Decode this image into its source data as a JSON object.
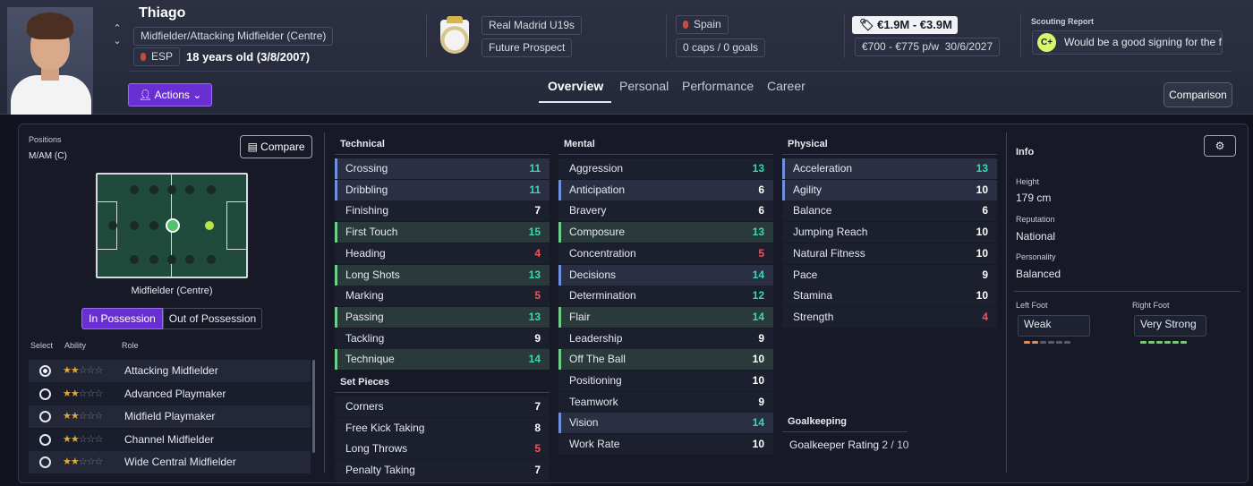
{
  "header": {
    "name": "Thiago",
    "position": "Midfielder/Attacking Midfielder (Centre)",
    "nation_code": "ESP",
    "age": "18 years old (3/8/2007)",
    "actions_label": "Actions",
    "club": "Real Madrid U19s",
    "status": "Future Prospect",
    "nationality": "Spain",
    "caps": "0 caps / 0 goals",
    "value": "€1.9M - €3.9M",
    "wage": "€700 - €775 p/w",
    "contract": "30/6/2027",
    "scout_label": "Scouting Report",
    "scout_grade": "C+",
    "scout_text": "Would be a good signing for the fu...",
    "comparison_label": "Comparison"
  },
  "tabs": [
    "Overview",
    "Personal",
    "Performance",
    "Career"
  ],
  "positions": {
    "label": "Positions",
    "value": "M/AM (C)",
    "compare_label": "Compare",
    "role_name": "Midfielder (Centre)",
    "in_possession": "In Possession",
    "out_possession": "Out of Possession",
    "col_select": "Select",
    "col_ability": "Ability",
    "col_role": "Role",
    "roles": [
      {
        "name": "Attacking Midfielder",
        "stars": "★★☆☆☆",
        "selected": true
      },
      {
        "name": "Advanced Playmaker",
        "stars": "★★☆☆☆"
      },
      {
        "name": "Midfield Playmaker",
        "stars": "★★☆☆☆"
      },
      {
        "name": "Channel Midfielder",
        "stars": "★★☆☆☆"
      },
      {
        "name": "Wide Central Midfielder",
        "stars": "★★☆☆☆"
      }
    ]
  },
  "technical": {
    "title": "Technical",
    "items": [
      {
        "n": "Crossing",
        "v": "11"
      },
      {
        "n": "Dribbling",
        "v": "11"
      },
      {
        "n": "Finishing",
        "v": "7"
      },
      {
        "n": "First Touch",
        "v": "15"
      },
      {
        "n": "Heading",
        "v": "4"
      },
      {
        "n": "Long Shots",
        "v": "13"
      },
      {
        "n": "Marking",
        "v": "5"
      },
      {
        "n": "Passing",
        "v": "13"
      },
      {
        "n": "Tackling",
        "v": "9"
      },
      {
        "n": "Technique",
        "v": "14"
      }
    ]
  },
  "setpieces": {
    "title": "Set Pieces",
    "items": [
      {
        "n": "Corners",
        "v": "7"
      },
      {
        "n": "Free Kick Taking",
        "v": "8"
      },
      {
        "n": "Long Throws",
        "v": "5"
      },
      {
        "n": "Penalty Taking",
        "v": "7"
      }
    ]
  },
  "mental": {
    "title": "Mental",
    "items": [
      {
        "n": "Aggression",
        "v": "13"
      },
      {
        "n": "Anticipation",
        "v": "6"
      },
      {
        "n": "Bravery",
        "v": "6"
      },
      {
        "n": "Composure",
        "v": "13"
      },
      {
        "n": "Concentration",
        "v": "5"
      },
      {
        "n": "Decisions",
        "v": "14"
      },
      {
        "n": "Determination",
        "v": "12"
      },
      {
        "n": "Flair",
        "v": "14"
      },
      {
        "n": "Leadership",
        "v": "9"
      },
      {
        "n": "Off The Ball",
        "v": "10"
      },
      {
        "n": "Positioning",
        "v": "10"
      },
      {
        "n": "Teamwork",
        "v": "9"
      },
      {
        "n": "Vision",
        "v": "14"
      },
      {
        "n": "Work Rate",
        "v": "10"
      }
    ]
  },
  "physical": {
    "title": "Physical",
    "items": [
      {
        "n": "Acceleration",
        "v": "13"
      },
      {
        "n": "Agility",
        "v": "10"
      },
      {
        "n": "Balance",
        "v": "6"
      },
      {
        "n": "Jumping Reach",
        "v": "10"
      },
      {
        "n": "Natural Fitness",
        "v": "10"
      },
      {
        "n": "Pace",
        "v": "9"
      },
      {
        "n": "Stamina",
        "v": "10"
      },
      {
        "n": "Strength",
        "v": "4"
      }
    ]
  },
  "goalkeeping": {
    "title": "Goalkeeping",
    "rating_label": "Goalkeeper Rating",
    "rating": "2 / 10"
  },
  "info": {
    "title": "Info",
    "height_label": "Height",
    "height": "179 cm",
    "rep_label": "Reputation",
    "rep": "National",
    "pers_label": "Personality",
    "pers": "Balanced",
    "lf_label": "Left Foot",
    "lf": "Weak",
    "rf_label": "Right Foot",
    "rf": "Very Strong"
  },
  "colors": {
    "accent": "#6a2fd2",
    "high": "#3fd6b0",
    "mid": "#ffffff",
    "low": "#f2545b"
  }
}
